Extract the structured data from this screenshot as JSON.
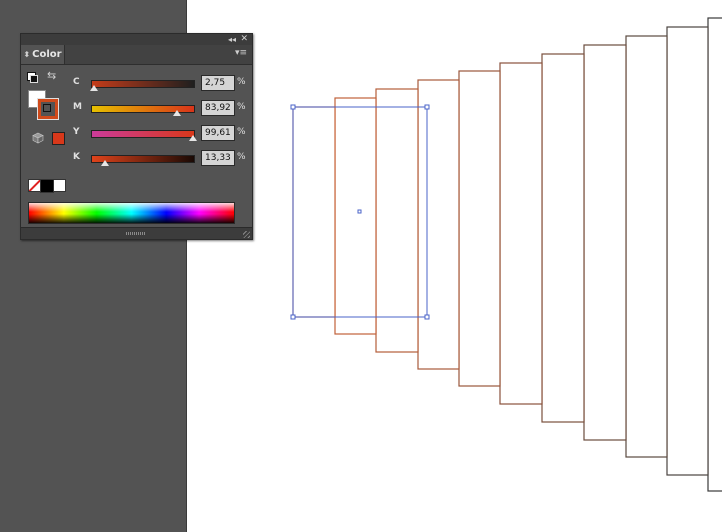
{
  "panel": {
    "tab_title": "Color",
    "tab_arrows_icon": "up-down-arrows-icon",
    "collapse_icon": "◂◂",
    "close_icon": "✕",
    "menu_icon": "▾≡",
    "swap_icon": "⇆",
    "fill_color": "#ffffff",
    "stroke_color": "#cf4a1b",
    "out_of_web_gamut_swatch": "#d8381a",
    "sliders": [
      {
        "label": "C",
        "value": "2,75",
        "unit": "%",
        "percent": 2.75,
        "gradient": [
          "#c43c1a",
          "#1f1f1f"
        ]
      },
      {
        "label": "M",
        "value": "83,92",
        "unit": "%",
        "percent": 83.92,
        "gradient": [
          "#e6c000",
          "#d8341a"
        ]
      },
      {
        "label": "Y",
        "value": "99,61",
        "unit": "%",
        "percent": 99.61,
        "gradient": [
          "#cc3b9a",
          "#d8381a"
        ]
      },
      {
        "label": "K",
        "value": "13,33",
        "unit": "%",
        "percent": 13.33,
        "gradient": [
          "#e0431a",
          "#1a0a05"
        ]
      }
    ],
    "quick_swatches": [
      "none",
      "#000000",
      "#ffffff"
    ]
  },
  "canvas": {
    "pasteboard_color": "#535353",
    "artboard_color": "#ffffff",
    "selection_color": "#4a63c8",
    "stroke_gradient_start": "#c8643a",
    "stroke_gradient_end": "#3a3a3a",
    "rectangle_count": 11
  }
}
